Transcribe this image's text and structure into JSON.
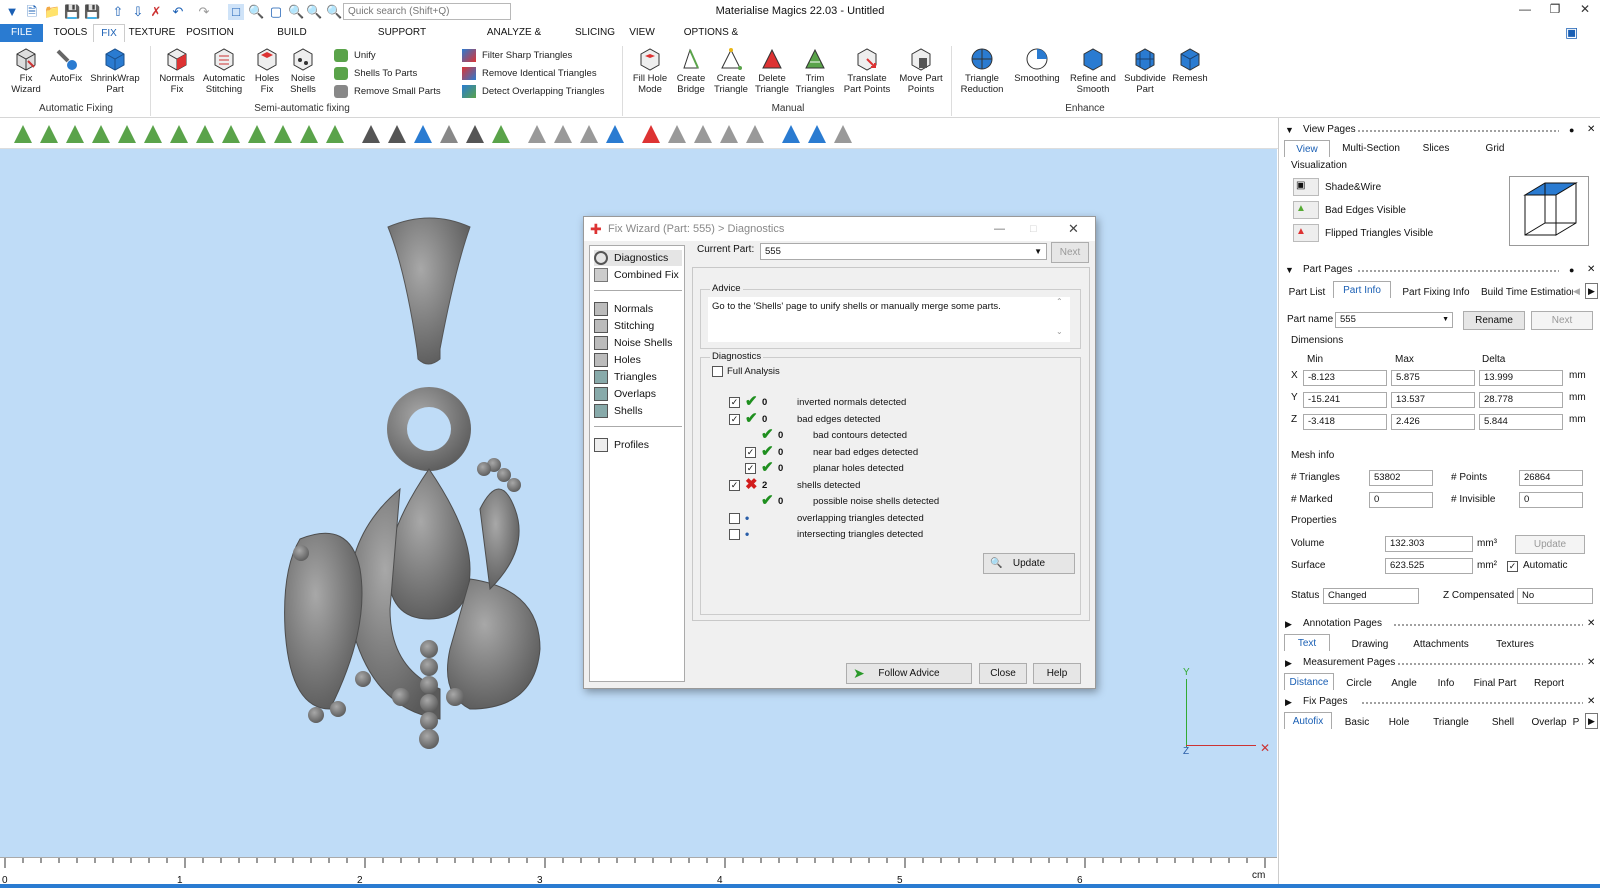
{
  "app": {
    "title": "Materialise Magics 22.03 - Untitled",
    "search_placeholder": "Quick search (Shift+Q)"
  },
  "menu": {
    "tabs": [
      "FILE",
      "TOOLS",
      "FIX",
      "TEXTURE",
      "POSITION",
      "BUILD PREPARATION",
      "SUPPORT GENERATION",
      "ANALYZE & REPORT",
      "SLICING",
      "VIEW",
      "OPTIONS & HELP"
    ],
    "active": "FIX"
  },
  "ribbon": {
    "automatic_fixing": {
      "group": "Automatic Fixing",
      "buttons": [
        {
          "l1": "Fix",
          "l2": "Wizard"
        },
        {
          "l1": "AutoFix",
          "l2": ""
        },
        {
          "l1": "ShrinkWrap",
          "l2": "Part"
        }
      ]
    },
    "semi": {
      "group": "Semi-automatic fixing",
      "buttons": [
        {
          "l1": "Normals",
          "l2": "Fix"
        },
        {
          "l1": "Automatic",
          "l2": "Stitching"
        },
        {
          "l1": "Holes",
          "l2": "Fix"
        },
        {
          "l1": "Noise",
          "l2": "Shells"
        }
      ],
      "small": [
        "Unify",
        "Shells To Parts",
        "Remove Small Parts"
      ]
    },
    "filter": [
      "Filter Sharp Triangles",
      "Remove Identical Triangles",
      "Detect Overlapping Triangles"
    ],
    "manual": {
      "group": "Manual",
      "buttons": [
        {
          "l1": "Fill Hole",
          "l2": "Mode"
        },
        {
          "l1": "Create",
          "l2": "Bridge"
        },
        {
          "l1": "Create",
          "l2": "Triangle"
        },
        {
          "l1": "Delete",
          "l2": "Triangle"
        },
        {
          "l1": "Trim",
          "l2": "Triangles"
        },
        {
          "l1": "Translate",
          "l2": "Part Points"
        },
        {
          "l1": "Move Part",
          "l2": "Points"
        }
      ]
    },
    "enhance": {
      "group": "Enhance",
      "buttons": [
        {
          "l1": "Triangle",
          "l2": "Reduction"
        },
        {
          "l1": "Smoothing",
          "l2": ""
        },
        {
          "l1": "Refine and",
          "l2": "Smooth"
        },
        {
          "l1": "Subdivide",
          "l2": "Part"
        },
        {
          "l1": "Remesh",
          "l2": ""
        }
      ]
    }
  },
  "ruler": {
    "labels": [
      "0",
      "1",
      "2",
      "3",
      "4",
      "5",
      "6"
    ],
    "unit": "cm"
  },
  "axes": {
    "y": "Y",
    "z": "Z"
  },
  "dialog": {
    "title": "Fix Wizard (Part: 555) > Diagnostics",
    "nav": [
      "Diagnostics",
      "Combined Fix",
      "Normals",
      "Stitching",
      "Noise Shells",
      "Holes",
      "Triangles",
      "Overlaps",
      "Shells",
      "Profiles"
    ],
    "current_part_label": "Current Part:",
    "current_part": "555",
    "next": "Next",
    "advice_label": "Advice",
    "advice": "Go to the 'Shells' page to unify shells or manually merge some parts.",
    "diagnostics_label": "Diagnostics",
    "full_analysis": "Full Analysis",
    "rows": [
      {
        "checked": true,
        "status": "ok",
        "count": "0",
        "text": "inverted normals detected",
        "indent": 0,
        "box": true
      },
      {
        "checked": true,
        "status": "ok",
        "count": "0",
        "text": "bad edges detected",
        "indent": 0,
        "box": true
      },
      {
        "checked": false,
        "status": "ok",
        "count": "0",
        "text": "bad contours detected",
        "indent": 1,
        "box": false
      },
      {
        "checked": true,
        "status": "ok",
        "count": "0",
        "text": "near bad edges detected",
        "indent": 1,
        "box": true
      },
      {
        "checked": true,
        "status": "ok",
        "count": "0",
        "text": "planar holes detected",
        "indent": 1,
        "box": true
      },
      {
        "checked": true,
        "status": "bad",
        "count": "2",
        "text": "shells detected",
        "indent": 0,
        "box": true
      },
      {
        "checked": false,
        "status": "ok",
        "count": "0",
        "text": "possible noise shells detected",
        "indent": 1,
        "box": false
      },
      {
        "checked": false,
        "status": "dot",
        "count": "",
        "text": "overlapping triangles detected",
        "indent": 0,
        "box": true
      },
      {
        "checked": false,
        "status": "dot",
        "count": "",
        "text": "intersecting triangles detected",
        "indent": 0,
        "box": true
      }
    ],
    "update": "Update",
    "follow_advice": "Follow Advice",
    "close": "Close",
    "help": "Help"
  },
  "view_pages": {
    "title": "View Pages",
    "tabs": [
      "View",
      "Multi-Section",
      "Slices",
      "Grid"
    ],
    "visualization_label": "Visualization",
    "options": [
      "Shade&Wire",
      "Bad Edges Visible",
      "Flipped Triangles Visible"
    ]
  },
  "part_pages": {
    "title": "Part Pages",
    "tabs": [
      "Part List",
      "Part Info",
      "Part Fixing Info",
      "Build Time Estimation"
    ],
    "part_name_label": "Part name",
    "part_name": "555",
    "rename": "Rename",
    "next": "Next",
    "dimensions_label": "Dimensions",
    "cols": [
      "Min",
      "Max",
      "Delta"
    ],
    "dims": [
      {
        "axis": "X",
        "min": "-8.123",
        "max": "5.875",
        "delta": "13.999",
        "unit": "mm"
      },
      {
        "axis": "Y",
        "min": "-15.241",
        "max": "13.537",
        "delta": "28.778",
        "unit": "mm"
      },
      {
        "axis": "Z",
        "min": "-3.418",
        "max": "2.426",
        "delta": "5.844",
        "unit": "mm"
      }
    ],
    "mesh_label": "Mesh info",
    "triangles_label": "# Triangles",
    "triangles": "53802",
    "points_label": "# Points",
    "points": "26864",
    "marked_label": "# Marked",
    "marked": "0",
    "invisible_label": "# Invisible",
    "invisible": "0",
    "properties_label": "Properties",
    "volume_label": "Volume",
    "volume": "132.303",
    "volume_unit": "mm³",
    "update": "Update",
    "surface_label": "Surface",
    "surface": "623.525",
    "surface_unit": "mm²",
    "automatic": "Automatic",
    "status_label": "Status",
    "status": "Changed",
    "zcomp_label": "Z Compensated",
    "zcomp": "No"
  },
  "annotation_pages": {
    "title": "Annotation Pages",
    "tabs": [
      "Text",
      "Drawing",
      "Attachments",
      "Textures"
    ]
  },
  "measurement_pages": {
    "title": "Measurement Pages",
    "tabs": [
      "Distance",
      "Circle",
      "Angle",
      "Info",
      "Final Part",
      "Report"
    ]
  },
  "fix_pages": {
    "title": "Fix Pages",
    "tabs": [
      "Autofix",
      "Basic",
      "Hole",
      "Triangle",
      "Shell",
      "Overlap",
      "P"
    ]
  },
  "colors": {
    "accent": "#2a7bd1",
    "viewport": "#bfdcf7",
    "ok": "#1f8f1f",
    "error": "#d21c1c"
  }
}
